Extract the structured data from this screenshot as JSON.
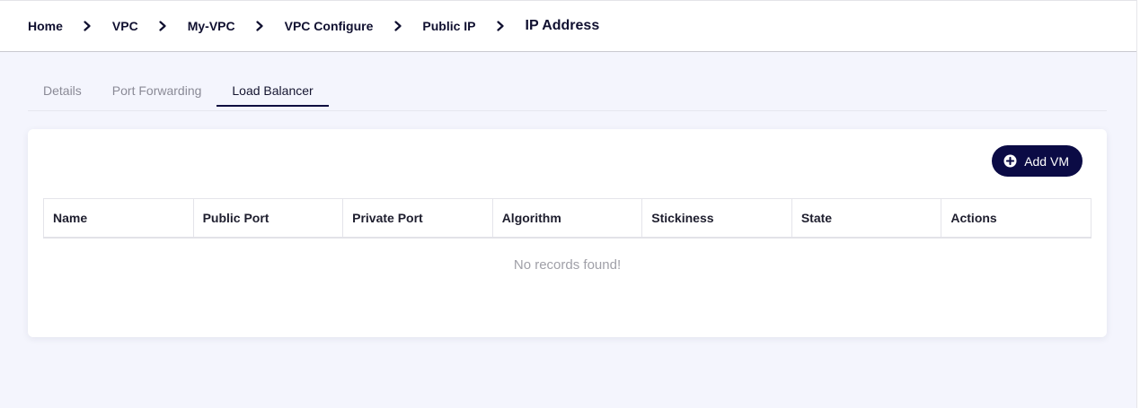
{
  "breadcrumb": {
    "items": [
      {
        "label": "Home"
      },
      {
        "label": "VPC"
      },
      {
        "label": "My-VPC"
      },
      {
        "label": "VPC Configure"
      },
      {
        "label": "Public IP"
      }
    ],
    "current": "IP Address",
    "separator_icon": "chevron-right-icon"
  },
  "tabs": [
    {
      "label": "Details",
      "active": false
    },
    {
      "label": "Port Forwarding",
      "active": false
    },
    {
      "label": "Load Balancer",
      "active": true
    }
  ],
  "toolbar": {
    "add_label": "Add VM",
    "add_icon": "plus-circle-icon"
  },
  "table": {
    "columns": [
      "Name",
      "Public Port",
      "Private Port",
      "Algorithm",
      "Stickiness",
      "State",
      "Actions"
    ],
    "rows": [],
    "empty_text": "No records found!"
  },
  "colors": {
    "accent": "#0b0b45",
    "background": "#f4f5fd",
    "muted_text": "#8a8a96"
  }
}
